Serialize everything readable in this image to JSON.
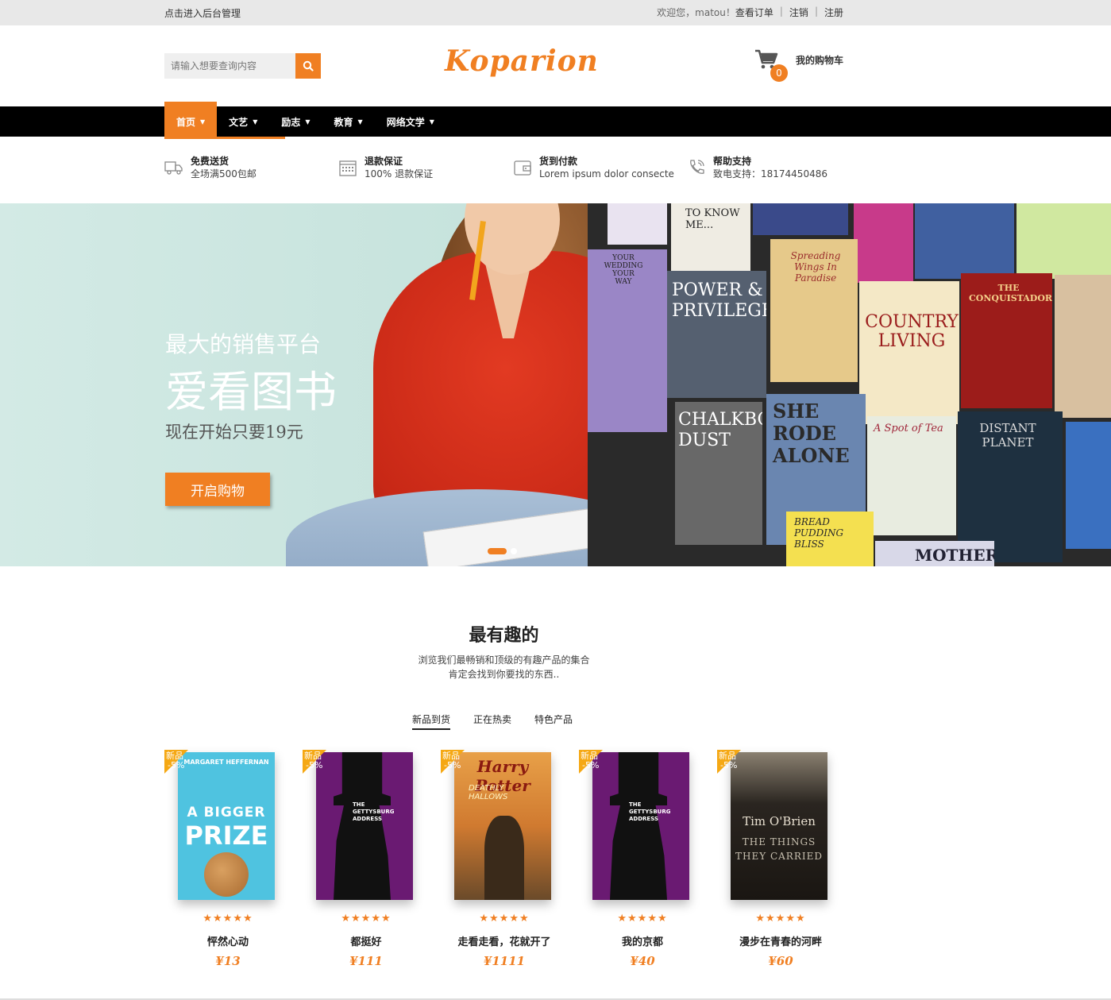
{
  "topbar": {
    "admin_link": "点击进入后台管理",
    "greeting": "欢迎您，matou！",
    "orders": "查看订单",
    "logout": "注销",
    "register": "注册",
    "separator": "|"
  },
  "header": {
    "search_placeholder": "请输入想要查询内容",
    "logo": "Koparion",
    "cart_count": "0",
    "cart_label": "我的购物车"
  },
  "nav": {
    "items": [
      {
        "label": "首页"
      },
      {
        "label": "文艺"
      },
      {
        "label": "励志"
      },
      {
        "label": "教育"
      },
      {
        "label": "网络文学"
      }
    ]
  },
  "features": [
    {
      "title": "免费送货",
      "desc": "全场满500包邮",
      "icon": "truck-icon"
    },
    {
      "title": "退款保证",
      "desc": "100% 退款保证",
      "icon": "calendar-icon"
    },
    {
      "title": "货到付款",
      "desc": "Lorem ipsum dolor consecte",
      "icon": "wallet-icon"
    },
    {
      "title": "帮助支持",
      "desc": "致电支持：18174450486",
      "icon": "phone-icon"
    }
  ],
  "hero": {
    "line1": "最大的销售平台",
    "line2": "爱看图书",
    "line3": "现在开始只要19元",
    "cta": "开启购物",
    "book_titles": {
      "b1": "TO KNOW ME...",
      "b2": "POWER & PRIVILEGE",
      "b3": "COUNTRY LIVING",
      "b4": "THE CONQUISTADORS",
      "b5": "CHALKBOARD DUST",
      "b6": "SHE RODE ALONE",
      "b7": "DISTANT PLANET",
      "b8": "A Spot of Tea",
      "b9": "BREAD PUDDING BLISS",
      "b10": "MOTHER",
      "b11": "Spreading Wings In Paradise",
      "b12": "YOUR WEDDING YOUR WAY"
    }
  },
  "section": {
    "title": "最有趣的",
    "desc1": "浏览我们最畅销和顶级的有趣产品的集合",
    "desc2": "肯定会找到你要找的东西..",
    "tabs": [
      "新品到货",
      "正在热卖",
      "特色产品"
    ]
  },
  "products": [
    {
      "name": "怦然心动",
      "price": "¥13",
      "badge_new": "新品",
      "badge_off": "-5%",
      "stars": "★★★★★",
      "cover_author": "MARGARET HEFFERNAN",
      "cover_title1": "A BIGGER",
      "cover_title2": "PRIZE"
    },
    {
      "name": "都挺好",
      "price": "¥111",
      "badge_new": "新品",
      "badge_off": "-5%",
      "stars": "★★★★★",
      "cover_title1": "THE GETTYSBURG ADDRESS"
    },
    {
      "name": "走看走看，花就开了",
      "price": "¥1111",
      "badge_new": "新品",
      "badge_off": "-5%",
      "stars": "★★★★★",
      "cover_title1": "Harry Potter",
      "cover_title2": "DEATHLY HALLOWS"
    },
    {
      "name": "我的京都",
      "price": "¥40",
      "badge_new": "新品",
      "badge_off": "-5%",
      "stars": "★★★★★",
      "cover_title1": "THE GETTYSBURG ADDRESS"
    },
    {
      "name": "漫步在青春的河畔",
      "price": "¥60",
      "badge_new": "新品",
      "badge_off": "-5%",
      "stars": "★★★★★",
      "cover_author": "Tim O'Brien",
      "cover_title1": "THE THINGS",
      "cover_title2": "THEY CARRIED"
    }
  ],
  "colors": {
    "accent": "#f07f22",
    "nav_bg": "#000000",
    "topbar_bg": "#e8e8e8"
  }
}
